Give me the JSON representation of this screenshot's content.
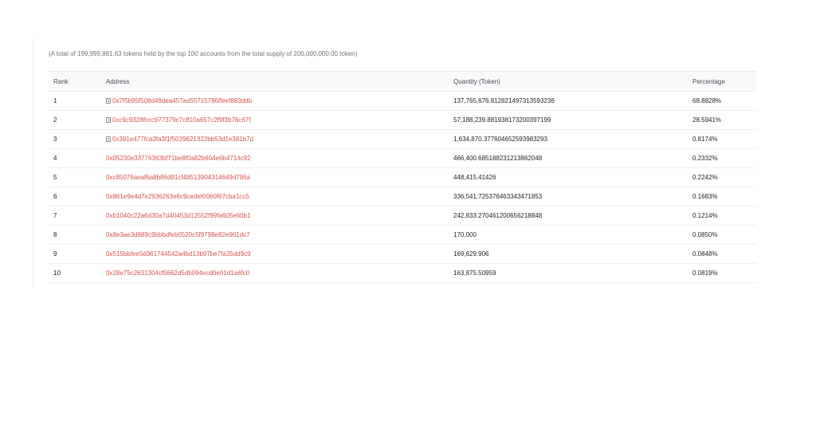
{
  "summary_text": "(A total of 199,999,881.63 tokens held by the top 100 accounts from the total supply of 200,000,000.00 token)",
  "columns": {
    "rank": "Rank",
    "address": "Address",
    "quantity": "Quantity (Token)",
    "percentage": "Percentage"
  },
  "colors": {
    "address_link": "#d9534f",
    "header_bg": "#f8f9fa"
  },
  "rows": [
    {
      "rank": "1",
      "address": "0x7f5b95f508d49dea457ad55715786ffeef883ddb",
      "is_contract": true,
      "quantity": "137,765,676.812821497313593236",
      "percentage": "68.8828%"
    },
    {
      "rank": "2",
      "address": "0xc9c9328fccc977379c7c810a657c2f9f3b76c67f",
      "is_contract": true,
      "quantity": "57,188,239.881938173200397199",
      "percentage": "28.5941%"
    },
    {
      "rank": "3",
      "address": "0x391e477fca3fa3f1f5039621322bb53d1e381b7d",
      "is_contract": true,
      "quantity": "1,634,870.377604652593983293",
      "percentage": "0.8174%"
    },
    {
      "rank": "4",
      "address": "0x05230e33776363bf71be8f0a82b604e6b4714c92",
      "is_contract": false,
      "quantity": "466,400.685188231213862048",
      "percentage": "0.2332%"
    },
    {
      "rank": "5",
      "address": "0xc85076aeaf6a8b86d91cf48513904314649d786a",
      "is_contract": false,
      "quantity": "448,415.41426",
      "percentage": "0.2242%"
    },
    {
      "rank": "6",
      "address": "0x861e9e4d7e2936263e6c9cedef0060f67cba1cc5",
      "is_contract": false,
      "quantity": "336,541.725376463343471853",
      "percentage": "0.1683%"
    },
    {
      "rank": "7",
      "address": "0xb1040c22a6d30a7d40453d12552f99fa605e60b1",
      "is_contract": false,
      "quantity": "242,833.270461200656218848",
      "percentage": "0.1214%"
    },
    {
      "rank": "8",
      "address": "0x8e3ae3d689c9bbbdfeb0520c5f9798e82e961dc7",
      "is_contract": false,
      "quantity": "170,000",
      "percentage": "0.0850%"
    },
    {
      "rank": "9",
      "address": "0x515bbfee5d361744542a4bd13b97be7fa35dd9c9",
      "is_contract": false,
      "quantity": "169,629.906",
      "percentage": "0.0848%"
    },
    {
      "rank": "10",
      "address": "0x28e75c2631304cf5662d5db094ecd0e01d1a6fc0",
      "is_contract": false,
      "quantity": "163,875.50959",
      "percentage": "0.0819%"
    }
  ]
}
